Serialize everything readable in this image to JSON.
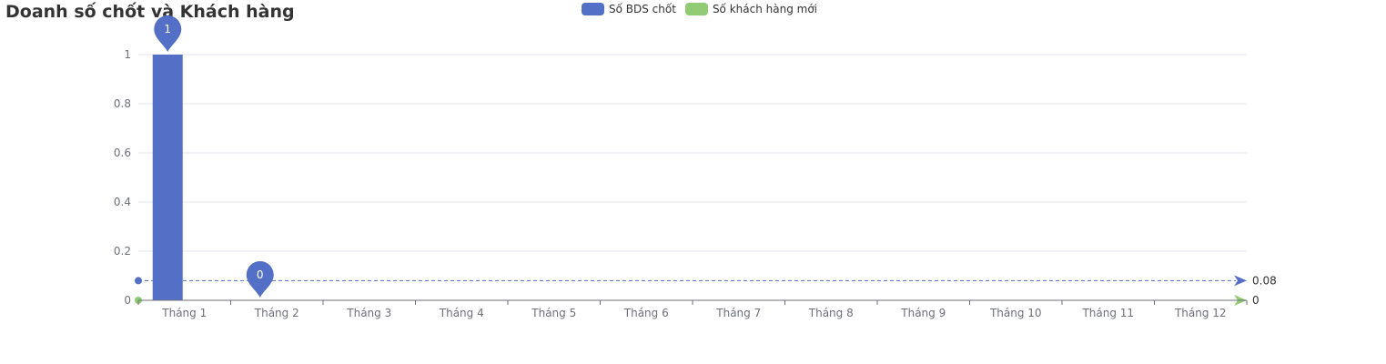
{
  "title": "Doanh số chốt và Khách hàng",
  "chart_data": {
    "type": "bar",
    "categories": [
      "Tháng 1",
      "Tháng 2",
      "Tháng 3",
      "Tháng 4",
      "Tháng 5",
      "Tháng 6",
      "Tháng 7",
      "Tháng 8",
      "Tháng 9",
      "Tháng 10",
      "Tháng 11",
      "Tháng 12"
    ],
    "series": [
      {
        "name": "Số BDS chốt",
        "type": "bar",
        "color": "#5470c6",
        "values": [
          1,
          0,
          0,
          0,
          0,
          0,
          0,
          0,
          0,
          0,
          0,
          0
        ],
        "mark_points": [
          {
            "category": "Tháng 1",
            "value": 1,
            "label": "1"
          },
          {
            "category": "Tháng 2",
            "value": 0,
            "label": "0"
          }
        ],
        "mark_line": {
          "value": 0.08,
          "label": "0.08"
        }
      },
      {
        "name": "Số khách hàng mới",
        "type": "bar",
        "color": "#91cc75",
        "values": [
          0,
          0,
          0,
          0,
          0,
          0,
          0,
          0,
          0,
          0,
          0,
          0
        ],
        "mark_line": {
          "value": 0,
          "label": "0"
        }
      }
    ],
    "yticks": [
      "0",
      "0.2",
      "0.4",
      "0.6",
      "0.8",
      "1"
    ],
    "ylim": [
      0,
      1
    ],
    "grid": true,
    "legend_position": "top-center"
  }
}
